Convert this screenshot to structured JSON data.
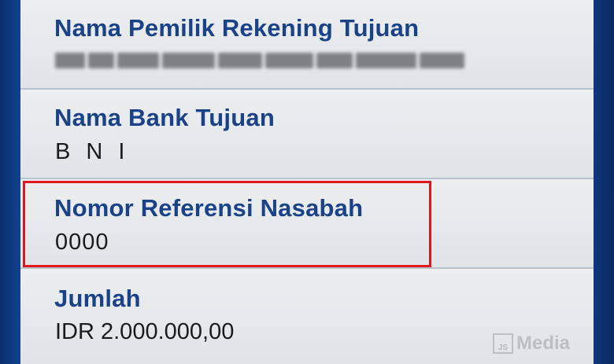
{
  "fields": [
    {
      "label": "Nama Pemilik Rekening Tujuan",
      "value": "",
      "value_obscured": true
    },
    {
      "label": "Nama Bank Tujuan",
      "value": "B N I"
    },
    {
      "label": "Nomor Referensi Nasabah",
      "value": "0000",
      "highlighted": true
    },
    {
      "label": "Jumlah",
      "value": "IDR 2.000.000,00"
    }
  ],
  "watermark": {
    "logo_text": "JS",
    "text": "Media"
  },
  "colors": {
    "label": "#1a4288",
    "value": "#1b1b1b",
    "highlight": "#e0161d",
    "background": "#12428f",
    "row": "#e6e8ea"
  }
}
